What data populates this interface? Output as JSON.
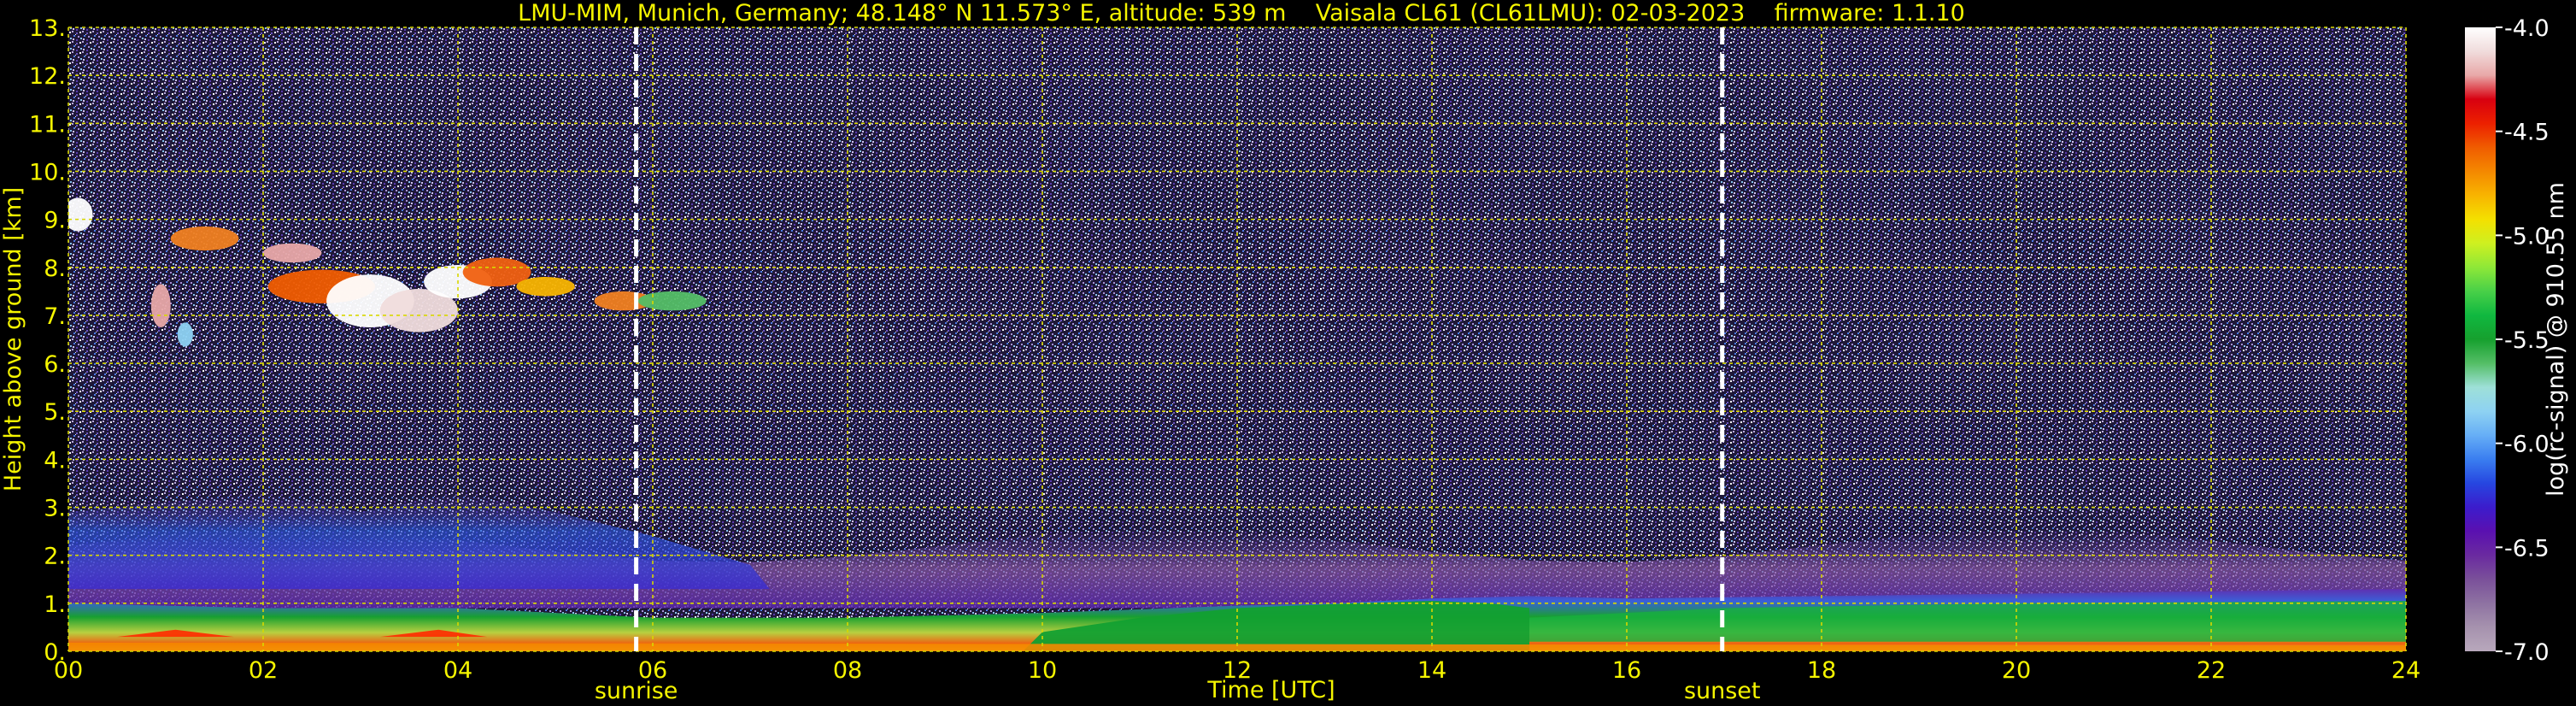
{
  "chart_data": {
    "type": "heatmap",
    "title": "LMU-MIM, Munich, Germany; 48.148° N 11.573° E, altitude: 539 m    Vaisala CL61 (CL61LMU): 02-03-2023    firmware: 1.1.10",
    "xlabel": "Time [UTC]",
    "ylabel": "Height above ground [km]",
    "xlim": [
      0,
      24
    ],
    "ylim": [
      0,
      13
    ],
    "x_ticks": [
      0,
      2,
      4,
      6,
      8,
      10,
      12,
      14,
      16,
      18,
      20,
      22,
      24
    ],
    "x_tick_labels": [
      "00",
      "02",
      "04",
      "06",
      "08",
      "10",
      "12",
      "14",
      "16",
      "18",
      "20",
      "22",
      "24"
    ],
    "y_ticks": [
      0,
      1,
      2,
      3,
      4,
      5,
      6,
      7,
      8,
      9,
      10,
      11,
      12,
      13
    ],
    "y_tick_labels": [
      "0.",
      "1.",
      "2.",
      "3.",
      "4.",
      "5.",
      "6.",
      "7.",
      "8.",
      "9.",
      "10.",
      "11.",
      "12.",
      "13."
    ],
    "grid": true,
    "background_color": "#000000",
    "text_color": "#f5f500",
    "colorbar": {
      "label": "log(rc-signal) @ 910.55 nm",
      "range": [
        -7.0,
        -4.0
      ],
      "ticks": [
        -7.0,
        -6.5,
        -6.0,
        -5.5,
        -5.0,
        -4.5,
        -4.0
      ],
      "tick_labels": [
        "-7.0",
        "-6.5",
        "-6.0",
        "-5.5",
        "-5.0",
        "-4.5",
        "-4.0"
      ],
      "colors": [
        "#b8a8bc",
        "#a692ae",
        "#8e72a2",
        "#7a509a",
        "#6a2aa0",
        "#5a10b0",
        "#3c1ccc",
        "#2646e0",
        "#3a7ef0",
        "#66aef6",
        "#8ed2f2",
        "#9ee0d8",
        "#54be66",
        "#16a02e",
        "#10b840",
        "#48d048",
        "#8ee838",
        "#cef020",
        "#f4e000",
        "#f8b400",
        "#f48800",
        "#f05c00",
        "#ec2000",
        "#d80010",
        "#e8a8a8",
        "#f0dcdc",
        "#ffffff"
      ]
    },
    "annotations": [
      {
        "label": "sunrise",
        "x": 5.83
      },
      {
        "label": "sunset",
        "x": 16.98
      }
    ],
    "features": [
      {
        "name": "cirrus cloud",
        "x_range": [
          0,
          7.2
        ],
        "height_range": [
          6.5,
          9.4
        ],
        "peak_value": -4.0
      },
      {
        "name": "residual aerosol layer",
        "x_range": [
          0,
          7.0
        ],
        "height_range": [
          1.5,
          3.5
        ],
        "peak_value": -6.5
      },
      {
        "name": "boundary layer",
        "x_range": [
          0,
          24
        ],
        "height_range": [
          0,
          1.2
        ],
        "peak_value": -5.3
      }
    ]
  }
}
